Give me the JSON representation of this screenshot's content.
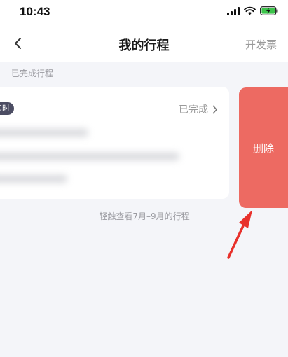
{
  "status_bar": {
    "time": "10:43",
    "icons": [
      "cellular-signal-icon",
      "wifi-icon",
      "battery-charging-icon"
    ]
  },
  "nav": {
    "back_icon": "chevron-left-icon",
    "title": "我的行程",
    "invoice_label": "开发票"
  },
  "section": {
    "label": "已完成行程"
  },
  "trip_card": {
    "time_tag": "实时",
    "status_label": "已完成",
    "status_icon": "chevron-right-icon"
  },
  "swipe_action": {
    "delete_label": "删除",
    "color": "#ed6a62"
  },
  "hint": "轻触查看7月–9月的行程",
  "annotation": {
    "icon": "red-arrow-icon",
    "color": "#e8302b"
  }
}
